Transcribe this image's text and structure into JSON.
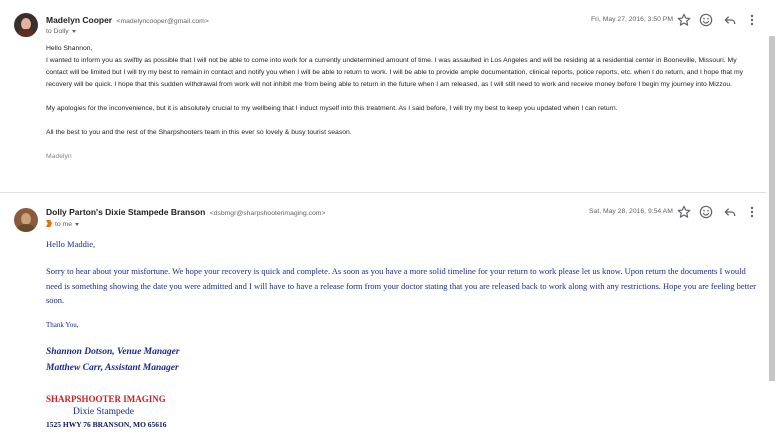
{
  "messages": [
    {
      "sender_name": "Madelyn Cooper",
      "sender_email": "<madelyncooper@gmail.com>",
      "to": "to Dolly",
      "date": "Fri, May 27, 2016, 3:50 PM",
      "body": {
        "greeting": "Hello Shannon,",
        "paragraph1": "I wanted to inform you as swiftly as possible that I will not be able to come into work for a currently undetermined amount of time. I was assaulted in Los Angeles and will be residing at a residential center in Booneville, Missouri. My contact will be limited but I will try my best to remain in contact and notify you when I will be able to return to work. I will be able to provide ample documentation, clinical reports, police reports, etc. when I do return, and I hope that my recovery will be quick. I hope that this sudden withdrawal from work will not inhibit me from being able to return in the future when I am released, as I will still need to work and receive money before I begin my journey into Mizzou.",
        "paragraph2": "My apologies for the inconvenience, but it is absolutely crucial to my wellbeing that I induct myself into this treatment. As I said before, I will try my best to keep you updated when I can return.",
        "paragraph3": "All the best to you and the rest of the Sharpshooters team in this ever so lovely & busy tourist season.",
        "signature": "Madelyn"
      }
    },
    {
      "sender_name": "Dolly Parton's Dixie Stampede Branson",
      "sender_email": "<dsbmgr@sharpshooterimaging.com>",
      "to": "to me",
      "date": "Sat, May 28, 2016, 9:54 AM",
      "body": {
        "greeting": "Hello Maddie,",
        "paragraph1": "Sorry to hear about your misfortune. We hope your recovery is quick and complete. As soon as you have a more solid timeline for your return to work please let us know.  Upon return the documents I would need is something showing the date you were admitted and I will have to have a release form from your doctor stating that you are released back to work along with any restrictions. Hope you are feeling better soon.",
        "thanks": "Thank You,",
        "manager1": "Shannon Dotson, Venue Manager",
        "manager2": "Matthew Carr, Assistant Manager",
        "company": "SHARPSHOOTER IMAGING",
        "venue": "Dixie Stampede",
        "address": "1525 HWY 76 BRANSON, MO 65616"
      }
    }
  ],
  "icons": {
    "star": "star-icon",
    "emoji": "emoji-icon",
    "reply": "reply-icon",
    "more": "more-vert-icon"
  },
  "colors": {
    "reply_text": "#1a2a8c",
    "company_red": "#d01f1f"
  }
}
